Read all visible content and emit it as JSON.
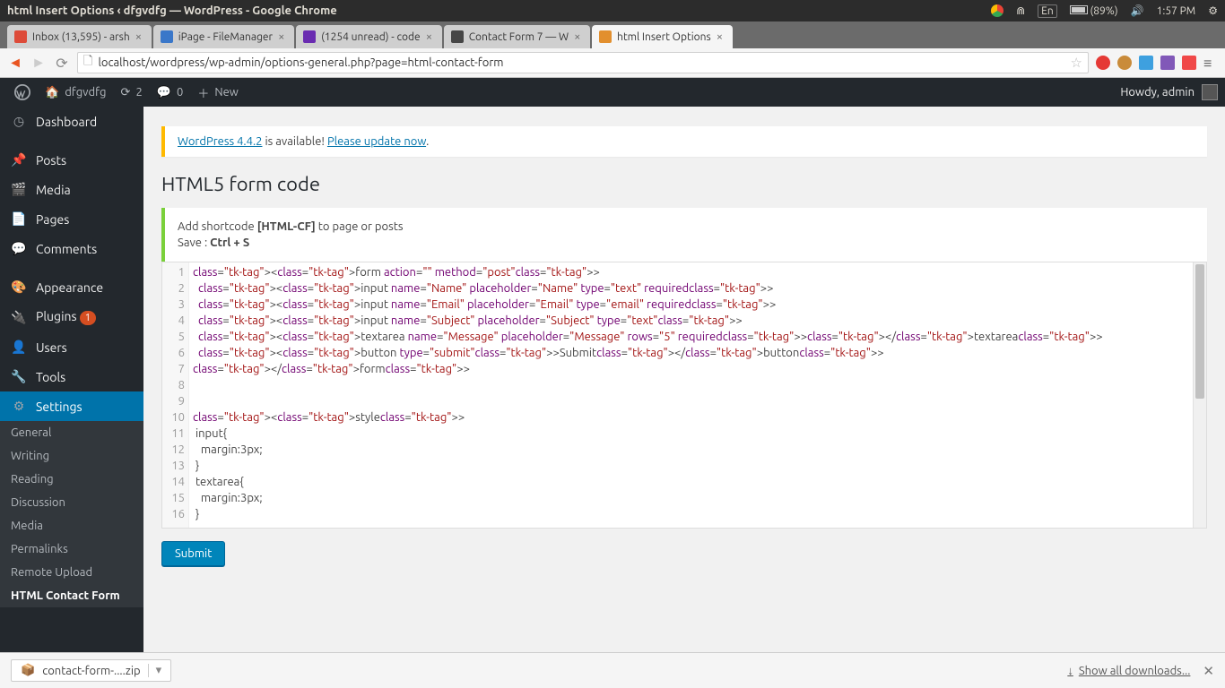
{
  "ubuntu": {
    "title": "html Insert Options ‹ dfgvdfg — WordPress - Google Chrome",
    "lang": "En",
    "battery": "(89%)",
    "time": "1:57 PM"
  },
  "tabs": [
    {
      "label": "Inbox (13,595) - arsh",
      "fav": "#dd4b39"
    },
    {
      "label": "iPage - FileManager",
      "fav": "#3a77c9"
    },
    {
      "label": "(1254 unread) - code",
      "fav": "#6a2cb1"
    },
    {
      "label": "Contact Form 7 — W",
      "fav": "#464646"
    },
    {
      "label": "html Insert Options",
      "fav": "#e28f2e",
      "active": true
    }
  ],
  "url": "localhost/wordpress/wp-admin/options-general.php?page=html-contact-form",
  "wpbar": {
    "site": "dfgvdfg",
    "updates": "2",
    "comments": "0",
    "new": "New",
    "howdy": "Howdy, admin"
  },
  "sidebar": {
    "items": [
      {
        "label": "Dashboard"
      },
      {
        "label": "Posts"
      },
      {
        "label": "Media"
      },
      {
        "label": "Pages"
      },
      {
        "label": "Comments"
      },
      {
        "label": "Appearance"
      },
      {
        "label": "Plugins",
        "badge": "1"
      },
      {
        "label": "Users"
      },
      {
        "label": "Tools"
      },
      {
        "label": "Settings"
      }
    ],
    "sub": [
      {
        "label": "General"
      },
      {
        "label": "Writing"
      },
      {
        "label": "Reading"
      },
      {
        "label": "Discussion"
      },
      {
        "label": "Media"
      },
      {
        "label": "Permalinks"
      },
      {
        "label": "Remote Upload"
      },
      {
        "label": "HTML Contact Form"
      }
    ]
  },
  "notice": {
    "version": "WordPress 4.4.2",
    "mid": " is available! ",
    "link": "Please update now"
  },
  "page": {
    "title": "HTML5 form code",
    "info1_pre": "Add shortcode ",
    "info1_bold": "[HTML-CF]",
    "info1_post": " to page or posts",
    "info2_pre": "Save : ",
    "info2_bold": "Ctrl + S",
    "submit": "Submit"
  },
  "code": {
    "lines": [
      "1",
      "2",
      "3",
      "4",
      "5",
      "6",
      "7",
      "8",
      "9",
      "10",
      "11",
      "12",
      "13",
      "14",
      "15",
      "16"
    ],
    "text": [
      "<form action=\"\" method=\"post\">",
      "  <input name=\"Name\" placeholder=\"Name\" type=\"text\" required>",
      "  <input name=\"Email\" placeholder=\"Email\" type=\"email\" required>",
      "  <input name=\"Subject\" placeholder=\"Subject\" type=\"text\">",
      "  <textarea name=\"Message\" placeholder=\"Message\" rows=\"5\" required></textarea>",
      "  <button type=\"submit\">Submit</button>",
      "</form>",
      "",
      "",
      "<style>",
      " input{",
      "   margin:3px;",
      " }",
      " textarea{",
      "   margin:3px;",
      " }"
    ]
  },
  "download": {
    "file": "contact-form-....zip",
    "all": "Show all downloads..."
  }
}
